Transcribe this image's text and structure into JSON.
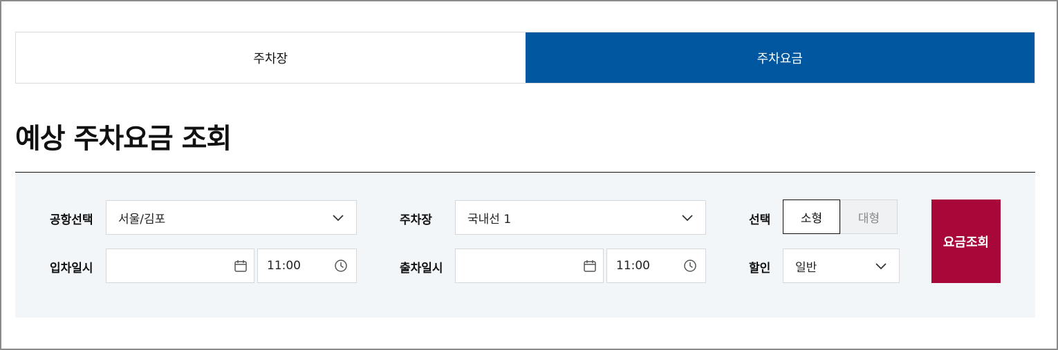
{
  "tabs": [
    {
      "label": "주차장",
      "active": false
    },
    {
      "label": "주차요금",
      "active": true
    }
  ],
  "page_title": "예상 주차요금 조회",
  "form": {
    "airport": {
      "label": "공항선택",
      "value": "서울/김포"
    },
    "parking_lot": {
      "label": "주차장",
      "value": "국내선 1"
    },
    "vehicle_type": {
      "label": "선택",
      "options": [
        "소형",
        "대형"
      ],
      "selected": "소형"
    },
    "entry": {
      "label": "입차일시",
      "date": "",
      "time": "11:00"
    },
    "exit": {
      "label": "출차일시",
      "date": "",
      "time": "11:00"
    },
    "discount": {
      "label": "할인",
      "value": "일반"
    },
    "submit_label": "요금조회"
  },
  "colors": {
    "tab_active": "#0057a0",
    "submit": "#a8073a",
    "panel_bg": "#f3f6f9"
  },
  "icons": [
    "chevron-down-icon",
    "calendar-icon",
    "clock-icon"
  ]
}
